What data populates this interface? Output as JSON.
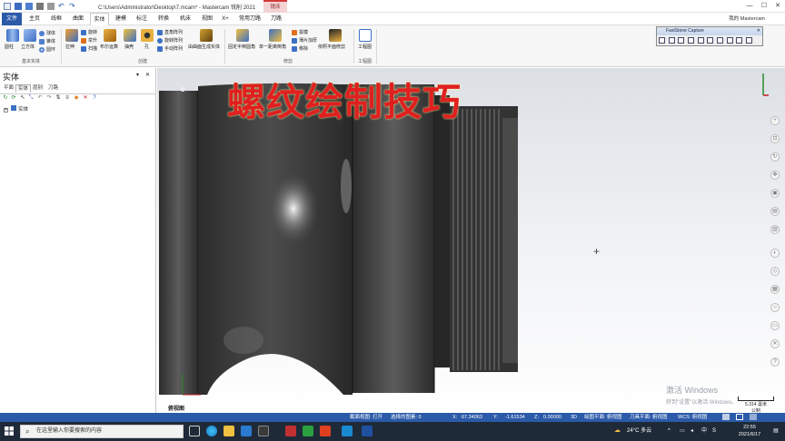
{
  "titlebar": {
    "title": "C:\\Users\\Administrator\\Desktop\\7.mcam* - Mastercam 铣削 2021",
    "context_tab": "铣床",
    "minimize": "—",
    "maximize": "☐",
    "close": "✕"
  },
  "tabs": [
    "文件",
    "主页",
    "线框",
    "曲面",
    "实体",
    "建模",
    "标注",
    "转换",
    "机床",
    "视图",
    "X+",
    "常用刀路",
    "刀路"
  ],
  "active_tab": "实体",
  "user_label": "我的 Mastercam",
  "ribbon": {
    "groups": [
      {
        "label": "基本实体",
        "items": [
          "圆柱",
          "立方体",
          "球体",
          "锥体",
          "圆环"
        ]
      },
      {
        "label": "创建",
        "items": [
          "拉伸",
          "旋转",
          "举升",
          "扫描",
          "布尔运算",
          "抽壳",
          "孔",
          "直角阵列",
          "旋转阵列",
          "手动阵列",
          "由曲面生成实体"
        ]
      },
      {
        "label": "修剪",
        "items": [
          "固定半倒圆角",
          "单一距离倒角",
          "拔模",
          "薄片加厚",
          "依照平面修剪",
          "移除"
        ]
      },
      {
        "label": "工程图",
        "items": [
          "工程图"
        ]
      }
    ]
  },
  "faststone": {
    "title": "FastStone Capture"
  },
  "left_panel": {
    "title": "实体",
    "tabs": [
      "平面",
      "实体",
      "层别",
      "刀路"
    ],
    "active_tab": "实体",
    "tree_root": "实体"
  },
  "viewport": {
    "overlay_title": "螺纹绘制技巧",
    "view_label": "俯视图",
    "axis_c": "C",
    "activate_line1": "激活 Windows",
    "activate_line2": "转到\"设置\"以激活 Windows。",
    "scale_value": "5.314 毫米",
    "scale_unit": "公制"
  },
  "statusbar": {
    "section_view": "截面视图: 打开",
    "selected": "选择的图素: 0",
    "x_label": "X:",
    "x_value": "67.34063",
    "y_label": "Y:",
    "y_value": "-1.61534",
    "z_label": "Z:",
    "z_value": "0.00000",
    "mode": "3D",
    "draw_plane": "绘图平面: 俯视图",
    "tool_plane": "刀具平面: 俯视图",
    "wcs": "WCS: 俯视图"
  },
  "taskbar": {
    "search_placeholder": "在这里输入你要搜索的内容",
    "weather": "24°C 多云",
    "time": "22:55",
    "date": "2021/6/17"
  },
  "colors": {
    "accent": "#2b5aa8",
    "overlay_text": "#e02020",
    "taskbar": "#1f2a38"
  }
}
